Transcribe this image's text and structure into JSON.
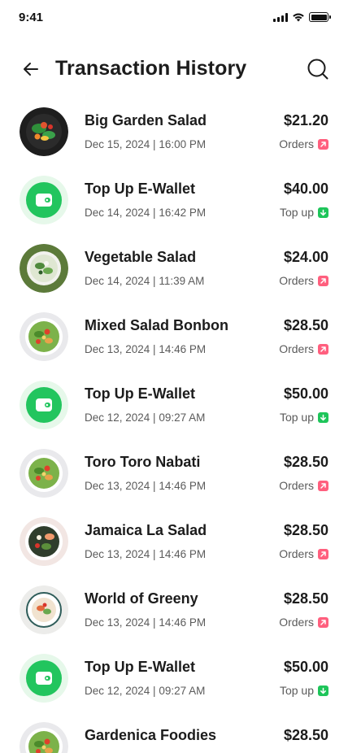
{
  "status": {
    "time": "9:41"
  },
  "header": {
    "title": "Transaction History"
  },
  "transactions": [
    {
      "name": "Big Garden Salad",
      "date": "Dec 15, 2024 | 16:00 PM",
      "amount": "$21.20",
      "type": "Orders",
      "direction": "up",
      "thumb": "salad-dark"
    },
    {
      "name": "Top Up E-Wallet",
      "date": "Dec 14, 2024 | 16:42 PM",
      "amount": "$40.00",
      "type": "Top up",
      "direction": "down",
      "thumb": "wallet"
    },
    {
      "name": "Vegetable Salad",
      "date": "Dec 14, 2024 | 11:39 AM",
      "amount": "$24.00",
      "type": "Orders",
      "direction": "up",
      "thumb": "salad-green"
    },
    {
      "name": "Mixed Salad Bonbon",
      "date": "Dec 13, 2024 | 14:46 PM",
      "amount": "$28.50",
      "type": "Orders",
      "direction": "up",
      "thumb": "salad-light"
    },
    {
      "name": "Top Up E-Wallet",
      "date": "Dec 12, 2024 | 09:27 AM",
      "amount": "$50.00",
      "type": "Top up",
      "direction": "down",
      "thumb": "wallet"
    },
    {
      "name": "Toro Toro Nabati",
      "date": "Dec 13, 2024 | 14:46 PM",
      "amount": "$28.50",
      "type": "Orders",
      "direction": "up",
      "thumb": "salad-light"
    },
    {
      "name": "Jamaica La Salad",
      "date": "Dec 13, 2024 | 14:46 PM",
      "amount": "$28.50",
      "type": "Orders",
      "direction": "up",
      "thumb": "salad-pink"
    },
    {
      "name": "World of Greeny",
      "date": "Dec 13, 2024 | 14:46 PM",
      "amount": "$28.50",
      "type": "Orders",
      "direction": "up",
      "thumb": "salad-bowl"
    },
    {
      "name": "Top Up E-Wallet",
      "date": "Dec 12, 2024 | 09:27 AM",
      "amount": "$50.00",
      "type": "Top up",
      "direction": "down",
      "thumb": "wallet"
    },
    {
      "name": "Gardenica Foodies",
      "date": "",
      "amount": "$28.50",
      "type": "",
      "direction": "",
      "thumb": "salad-light"
    }
  ],
  "colors": {
    "orders_badge": "#ff5f7e",
    "topup_badge": "#1ec55a",
    "wallet_green": "#22c55e",
    "wallet_ring": "#e6f8ea"
  },
  "icons": {
    "back": "arrow-left-icon",
    "search": "search-icon",
    "orders": "arrow-up-right-icon",
    "topup": "arrow-down-icon",
    "wallet": "wallet-icon"
  }
}
